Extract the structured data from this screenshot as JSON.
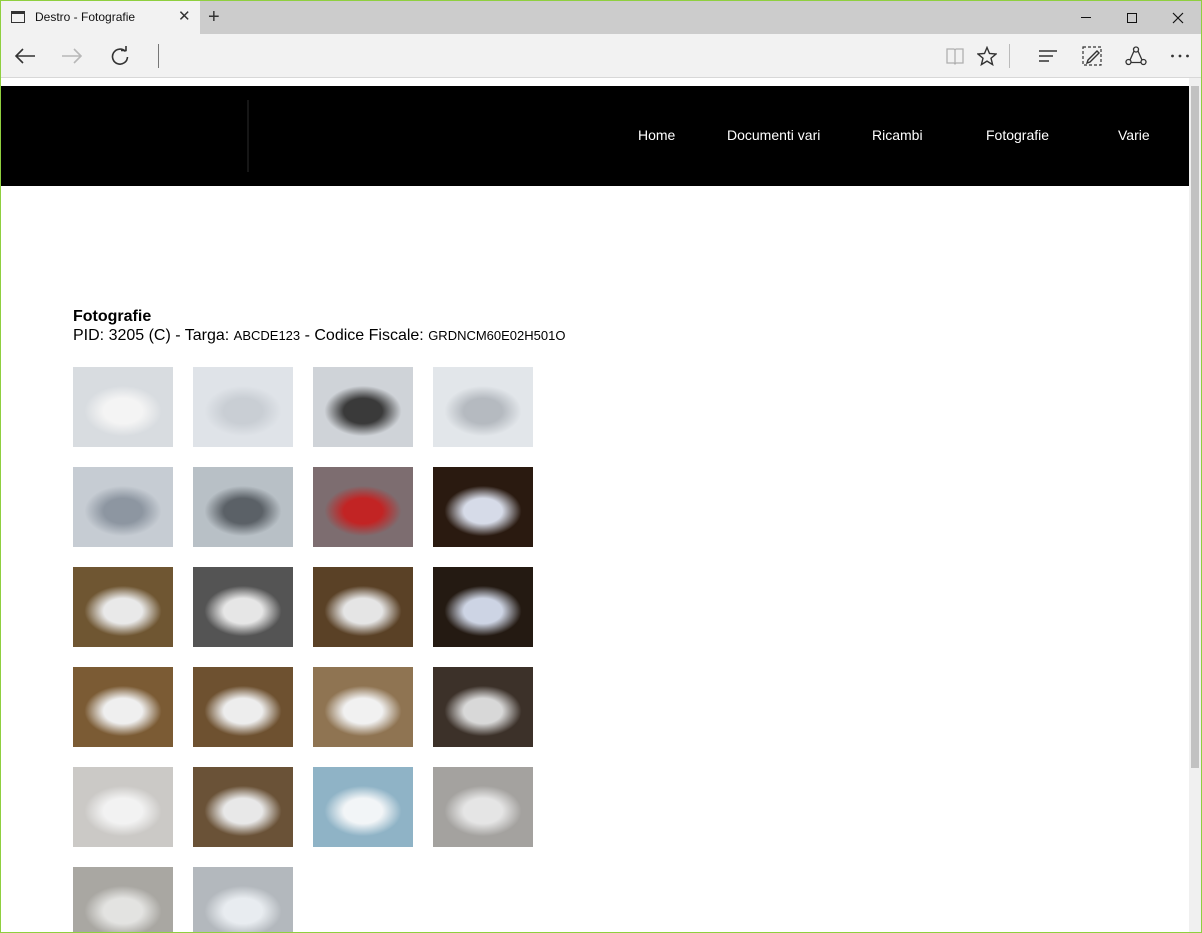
{
  "browser": {
    "tab_title": "Destro - Fotografie",
    "new_tab_symbol": "+",
    "close_symbol": "✕"
  },
  "site": {
    "menu": [
      "Home",
      "Documenti vari",
      "Ricambi",
      "Fotografie",
      "Varie"
    ]
  },
  "page": {
    "heading": "Fotografie",
    "pid_label": "PID: ",
    "pid_value": "3205 (C)",
    "targa_label": " - Targa: ",
    "targa_value": "ABCDE123",
    "cf_label": "  - Codice Fiscale: ",
    "cf_value": "GRDNCM60E02H501O"
  },
  "gallery": {
    "count": 22,
    "thumbs": [
      {
        "name": "photo-rear-car",
        "bg": "#d8dce0",
        "accent": "#f4f4f4"
      },
      {
        "name": "photo-bumper-scratch",
        "bg": "#dfe3e8",
        "accent": "#c9ced4"
      },
      {
        "name": "photo-bumper-damage",
        "bg": "#cfd3d8",
        "accent": "#3a3a3a"
      },
      {
        "name": "photo-bumper-closeup",
        "bg": "#e2e6ea",
        "accent": "#b5bac0"
      },
      {
        "name": "photo-panel-dent",
        "bg": "#c6ccd3",
        "accent": "#8d96a1"
      },
      {
        "name": "photo-wheel-arch",
        "bg": "#b8c0c6",
        "accent": "#5b6167"
      },
      {
        "name": "photo-tail-light",
        "bg": "#7d6d70",
        "accent": "#c22424"
      },
      {
        "name": "photo-license-plate-night",
        "bg": "#2a1a10",
        "accent": "#d6dbe8"
      },
      {
        "name": "photo-workshop-rear",
        "bg": "#6f5632",
        "accent": "#e9e9e9"
      },
      {
        "name": "photo-side-panel",
        "bg": "#545454",
        "accent": "#e6e6e6"
      },
      {
        "name": "photo-rear-lights-on",
        "bg": "#5a4126",
        "accent": "#e5e5e5"
      },
      {
        "name": "photo-plate-closeup",
        "bg": "#241a12",
        "accent": "#cdd4e4"
      },
      {
        "name": "photo-rear-repair-1",
        "bg": "#7b5b34",
        "accent": "#efefef"
      },
      {
        "name": "photo-rear-repair-2",
        "bg": "#6e5130",
        "accent": "#ededed"
      },
      {
        "name": "photo-bumper-removed",
        "bg": "#8f7452",
        "accent": "#f1f1f1"
      },
      {
        "name": "photo-bumper-dark",
        "bg": "#3c3129",
        "accent": "#d8d8d8"
      },
      {
        "name": "photo-rear-repaired",
        "bg": "#cbc9c6",
        "accent": "#f2f2f2"
      },
      {
        "name": "photo-bumper-on-floor",
        "bg": "#6a5237",
        "accent": "#e8e8e8"
      },
      {
        "name": "photo-document-hand",
        "bg": "#8fb3c6",
        "accent": "#f2f5f7"
      },
      {
        "name": "photo-front-damage",
        "bg": "#a4a29f",
        "accent": "#e5e5e5"
      },
      {
        "name": "photo-covered-car",
        "bg": "#a9a7a2",
        "accent": "#e3e3e1"
      },
      {
        "name": "photo-covered-bumper",
        "bg": "#b3b8bd",
        "accent": "#e8ecf0"
      }
    ]
  }
}
